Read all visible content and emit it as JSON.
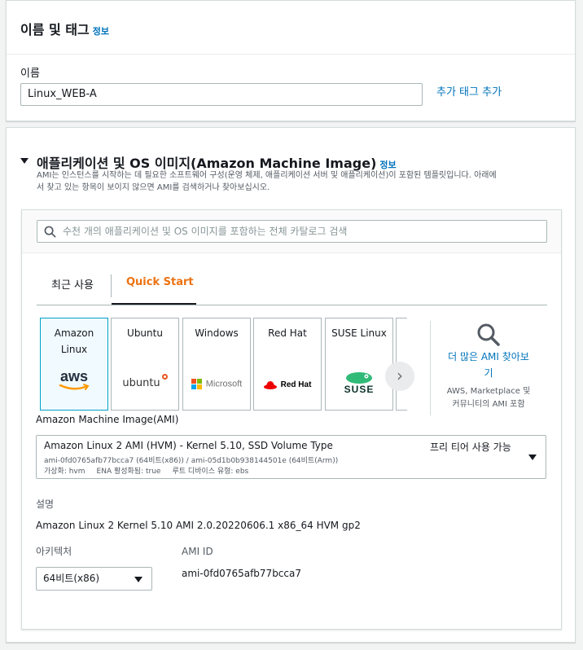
{
  "name_tags": {
    "title": "이름 및 태그",
    "info": "정보",
    "name_label": "이름",
    "name_value": "Linux_WEB-A",
    "add_tag_link": "추가 태그 추가"
  },
  "ami_section": {
    "title": "애플리케이션 및 OS 이미지(Amazon Machine Image)",
    "info": "정보",
    "desc_line1": "AMI는 인스턴스를 시작하는 데 필요한 소프트웨어 구성(운영 체제, 애플리케이션 서버 및 애플리케이션)이 포함된 템플릿입니다. 아래에",
    "desc_line2": "서 찾고 있는 항목이 보이지 않으면 AMI를 검색하거나 찾아보십시오.",
    "search_placeholder": "수천 개의 애플리케이션 및 OS 이미지를 포함하는 전체 카탈로그 검색",
    "tabs": [
      {
        "label": "최근 사용",
        "active": false
      },
      {
        "label": "Quick Start",
        "active": true
      }
    ],
    "os_options": [
      {
        "name_line1": "Amazon",
        "name_line2": "Linux",
        "logo": "aws-logo",
        "logo_text": "aws",
        "selected": true
      },
      {
        "name_line1": "Ubuntu",
        "name_line2": "",
        "logo": "ubuntu-logo",
        "logo_text": "ubuntu",
        "selected": false
      },
      {
        "name_line1": "Windows",
        "name_line2": "",
        "logo": "microsoft-logo",
        "logo_text": "Microsoft",
        "selected": false
      },
      {
        "name_line1": "Red Hat",
        "name_line2": "",
        "logo": "redhat-logo",
        "logo_text": "Red Hat",
        "selected": false
      },
      {
        "name_line1": "SUSE Linux",
        "name_line2": "",
        "logo": "suse-logo",
        "logo_text": "SUSE",
        "selected": false
      }
    ],
    "more_link_line1": "더 많은 AMI 찾아보",
    "more_link_line2": "기",
    "more_sub_line1": "AWS, Marketplace 및",
    "more_sub_line2": "커뮤니티의 AMI 포함",
    "ami_label": "Amazon Machine Image(AMI)",
    "ami_selected": {
      "name": "Amazon Linux 2 AMI (HVM) - Kernel 5.10, SSD Volume Type",
      "free_tier": "프리 티어 사용 가능",
      "ids": "ami-0fd0765afb77bcca7 (64비트(x86)) / ami-05d1b0b938144501e (64비트(Arm))",
      "virtualization": "가상화: hvm",
      "ena": "ENA 활성화됨: true",
      "root_device": "루트 디바이스 유형: ebs"
    },
    "description_label": "설명",
    "description_value": "Amazon Linux 2 Kernel 5.10 AMI 2.0.20220606.1 x86_64 HVM gp2",
    "arch_label": "아키텍처",
    "arch_value": "64비트(x86)",
    "ami_id_label": "AMI ID",
    "ami_id_value": "ami-0fd0765afb77bcca7"
  },
  "colors": {
    "link": "#0073bb",
    "active_tab": "#ec7211",
    "selected_border": "#00a1c9",
    "aws_orange": "#ff9900",
    "ubuntu_orange": "#e95420",
    "redhat_red": "#ee0000",
    "suse_green": "#30ba78"
  }
}
